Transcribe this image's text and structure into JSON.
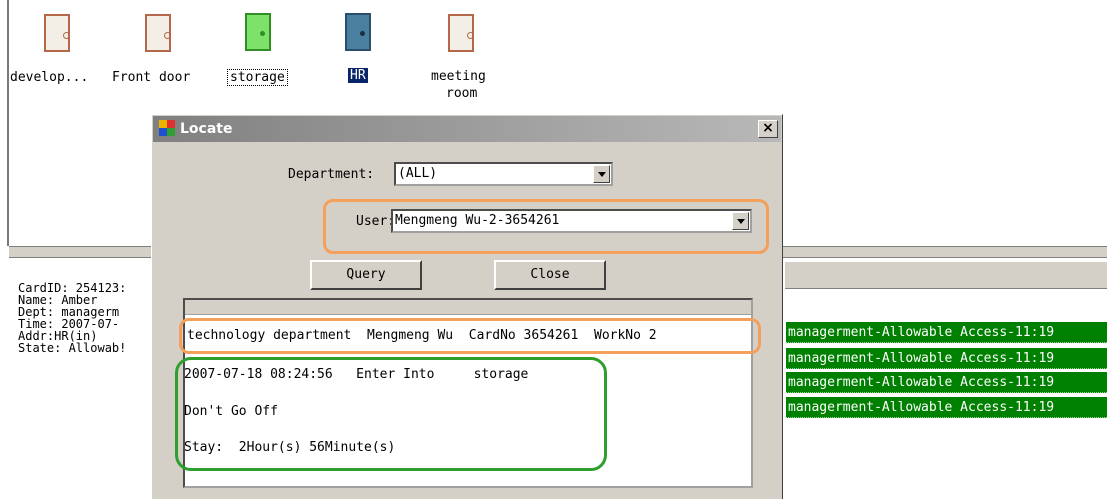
{
  "doors": [
    {
      "label": "develop...",
      "color": "#f4efe6",
      "border": "#b5674a",
      "selected": false,
      "highlighted": false
    },
    {
      "label": "Front door",
      "color": "#f4efe6",
      "border": "#b5674a",
      "selected": false,
      "highlighted": false
    },
    {
      "label": "storage",
      "color": "#7ee26a",
      "border": "#2e8f24",
      "selected": true,
      "highlighted": false
    },
    {
      "label": "HR",
      "color": "#4a7fa0",
      "border": "#2b4f6a",
      "selected": false,
      "highlighted": true
    },
    {
      "label": "meeting room",
      "line1": "meeting",
      "line2": "room",
      "color": "#f4efe6",
      "border": "#b5674a",
      "selected": false,
      "highlighted": false
    }
  ],
  "info": {
    "card_id": "CardID: 254123:",
    "name": "Name: Amber",
    "dept": "Dept: managerm",
    "time": "Time: 2007-07-",
    "addr": "Addr:HR(in)",
    "state": "State: Allowab!"
  },
  "log_rows": [
    "managerment-Allowable Access-11:19",
    "managerment-Allowable Access-11:19",
    "managerment-Allowable Access-11:19",
    "managerment-Allowable Access-11:19"
  ],
  "dialog": {
    "title": "Locate",
    "close_glyph": "×",
    "department_label": "Department:",
    "department_value": "(ALL)",
    "user_label": "User:",
    "user_value": "Mengmeng Wu-2-3654261",
    "query_label": "Query",
    "close_label": "Close",
    "result_header": "technology department  Mengmeng Wu  CardNo 3654261  WorkNo 2",
    "result_line1": "2007-07-18 08:24:56   Enter Into     storage",
    "result_line2": "Don't Go Off",
    "result_line3": "Stay:  2Hour(s) 56Minute(s)"
  },
  "colors": {
    "highlight_orange": "#f4a05a",
    "highlight_green": "#2e9e2e",
    "log_green": "#008000"
  }
}
